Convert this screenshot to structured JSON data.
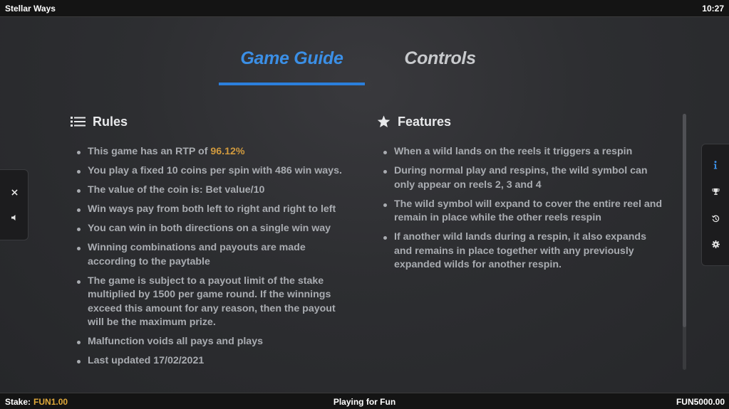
{
  "topbar": {
    "title": "Stellar Ways",
    "time": "10:27"
  },
  "tabs": [
    {
      "label": "Game Guide",
      "active": true
    },
    {
      "label": "Controls",
      "active": false
    }
  ],
  "rules": {
    "heading": "Rules",
    "items": [
      {
        "text": "This game has an RTP of ",
        "highlight": "96.12%"
      },
      {
        "text": "You play a fixed 10 coins per spin with 486 win ways."
      },
      {
        "text": "The value of the coin is: Bet value/10"
      },
      {
        "text": "Win ways pay from both left to right and right to left"
      },
      {
        "text": "You can win in both directions on a single win way"
      },
      {
        "text": "Winning combinations and payouts are made according to the paytable"
      },
      {
        "text": "The game is subject to a payout limit of the stake multiplied by 1500 per game round. If the winnings exceed this amount for any reason, then the payout will be the maximum prize."
      },
      {
        "text": "Malfunction voids all pays and plays"
      },
      {
        "text": "Last updated 17/02/2021"
      }
    ]
  },
  "features": {
    "heading": "Features",
    "items": [
      {
        "text": "When a wild lands on the reels it triggers a respin"
      },
      {
        "text": "During normal play and respins, the wild symbol can only appear on reels 2, 3 and 4"
      },
      {
        "text": "The wild symbol will expand to cover the entire reel and remain in place while the other reels respin"
      },
      {
        "text": "If another wild lands during a respin, it also expands and remains in place together with any previously expanded wilds for another respin."
      }
    ]
  },
  "left_panel": {
    "icons": [
      "close-icon",
      "sound-icon"
    ]
  },
  "right_panel": {
    "icons": [
      "info-icon",
      "trophy-icon",
      "history-icon",
      "settings-icon"
    ],
    "active": "info-icon"
  },
  "bottombar": {
    "stake_label": "Stake:",
    "stake_value": "FUN1.00",
    "mode": "Playing for Fun",
    "balance": "FUN5000.00"
  },
  "colors": {
    "accent": "#3b8fe6",
    "highlight": "#d19a3e",
    "stake": "#e0a93a",
    "text": "#a9acb1"
  }
}
